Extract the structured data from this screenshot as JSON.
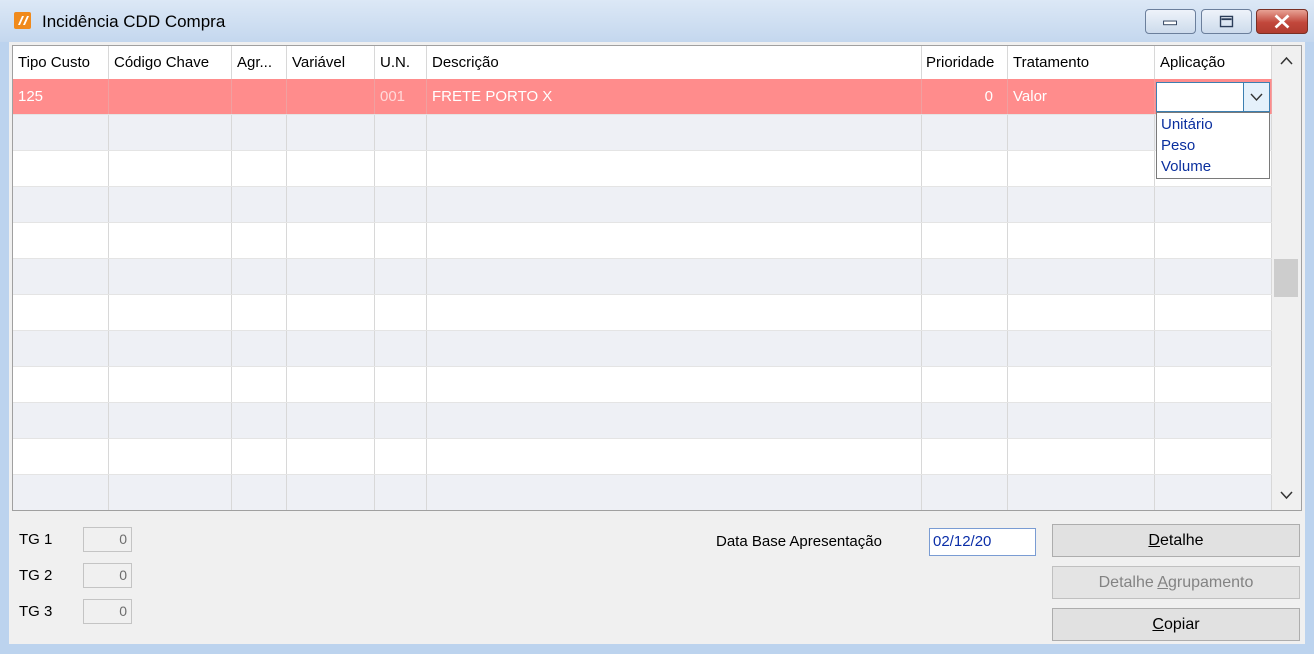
{
  "window": {
    "title": "Incidência CDD Compra"
  },
  "grid": {
    "columns": [
      "Tipo Custo",
      "Código Chave",
      "Agr...",
      "Variável",
      "U.N.",
      "Descrição",
      "Prioridade",
      "Tratamento",
      "Aplicação"
    ],
    "selected_row": {
      "tipo_custo": "125",
      "codigo_chave": "",
      "agr": "",
      "variavel": "",
      "un": "001",
      "descricao": "FRETE PORTO X",
      "prioridade": "0",
      "tratamento": "Valor",
      "aplicacao": ""
    },
    "aplicacao_options": [
      "Unitário",
      "Peso",
      "Volume"
    ],
    "empty_rows": 11
  },
  "totals": [
    {
      "label": "TG 1",
      "value": "0"
    },
    {
      "label": "TG 2",
      "value": "0"
    },
    {
      "label": "TG 3",
      "value": "0"
    }
  ],
  "data_base": {
    "label": "Data Base Apresentação",
    "value": "02/12/20"
  },
  "buttons": {
    "detalhe": {
      "before": "",
      "accel": "D",
      "after": "etalhe"
    },
    "detalhe_agrupamento": {
      "before": "Detalhe ",
      "accel": "A",
      "after": "grupamento"
    },
    "copiar": {
      "before": "",
      "accel": "C",
      "after": "opiar"
    }
  },
  "colors": {
    "selected_row": "#ff8c8c",
    "accent_text": "#0a2f9e"
  }
}
